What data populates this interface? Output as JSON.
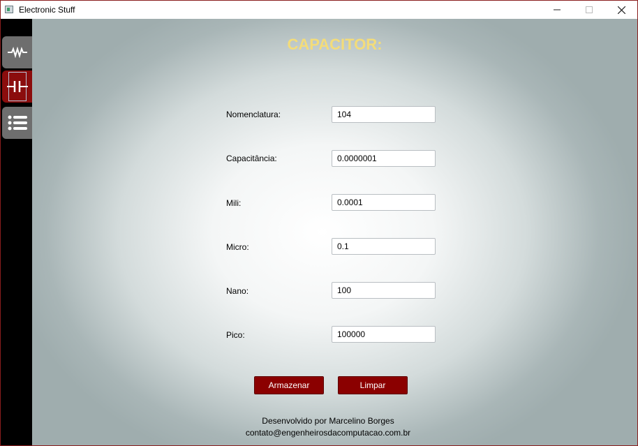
{
  "window": {
    "title": "Electronic Stuff"
  },
  "sidebar": {
    "items": [
      {
        "icon": "resistor-icon",
        "active": false
      },
      {
        "icon": "capacitor-icon",
        "active": true
      },
      {
        "icon": "list-icon",
        "active": false
      }
    ]
  },
  "main": {
    "heading": "CAPACITOR:",
    "fields": [
      {
        "label": "Nomenclatura:",
        "value": "104"
      },
      {
        "label": "Capacitância:",
        "value": "0.0000001"
      },
      {
        "label": "Mili:",
        "value": "0.0001"
      },
      {
        "label": "Micro:",
        "value": "0.1"
      },
      {
        "label": "Nano:",
        "value": "100"
      },
      {
        "label": "Pico:",
        "value": "100000"
      }
    ],
    "buttons": {
      "store": "Armazenar",
      "clear": "Limpar"
    },
    "footer": {
      "line1": "Desenvolvido por Marcelino Borges",
      "line2": "contato@engenheirosdacomputacao.com.br"
    }
  },
  "colors": {
    "accent": "#8b0000",
    "heading": "#f3dc7a",
    "sidebar": "#000000"
  }
}
